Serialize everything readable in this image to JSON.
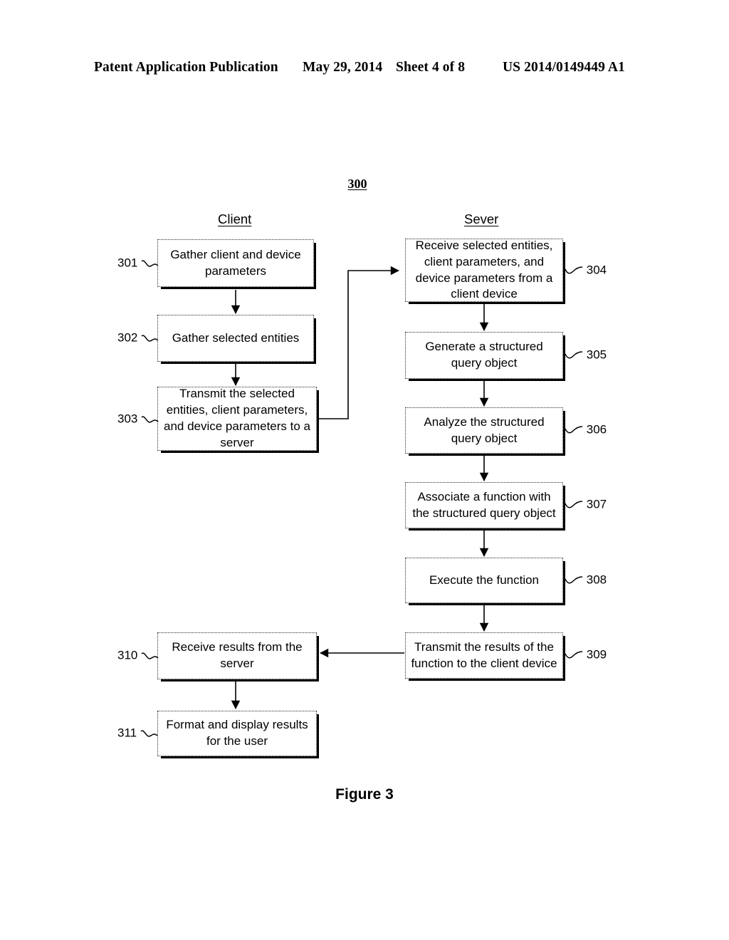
{
  "header": {
    "publication": "Patent Application Publication",
    "date": "May 29, 2014",
    "sheet": "Sheet 4 of 8",
    "patent_number": "US 2014/0149449 A1"
  },
  "figure": {
    "diagram_number": "300",
    "caption": "Figure 3",
    "columns": {
      "client": "Client",
      "server": "Sever"
    }
  },
  "nodes": {
    "n301": {
      "ref": "301",
      "text": "Gather client and device parameters"
    },
    "n302": {
      "ref": "302",
      "text": "Gather selected entities"
    },
    "n303": {
      "ref": "303",
      "text": "Transmit the selected entities, client parameters, and device parameters to a server"
    },
    "n304": {
      "ref": "304",
      "text": "Receive selected entities, client parameters, and device parameters from a client device"
    },
    "n305": {
      "ref": "305",
      "text": "Generate a structured query object"
    },
    "n306": {
      "ref": "306",
      "text": "Analyze the structured query object"
    },
    "n307": {
      "ref": "307",
      "text": "Associate a function with the structured query object"
    },
    "n308": {
      "ref": "308",
      "text": "Execute the function"
    },
    "n309": {
      "ref": "309",
      "text": "Transmit the results of the function to the client device"
    },
    "n310": {
      "ref": "310",
      "text": "Receive results from the server"
    },
    "n311": {
      "ref": "311",
      "text": "Format and display results for the user"
    }
  },
  "colors": {
    "ink": "#000000",
    "paper": "#ffffff",
    "box_border": "#2b2b2b"
  }
}
